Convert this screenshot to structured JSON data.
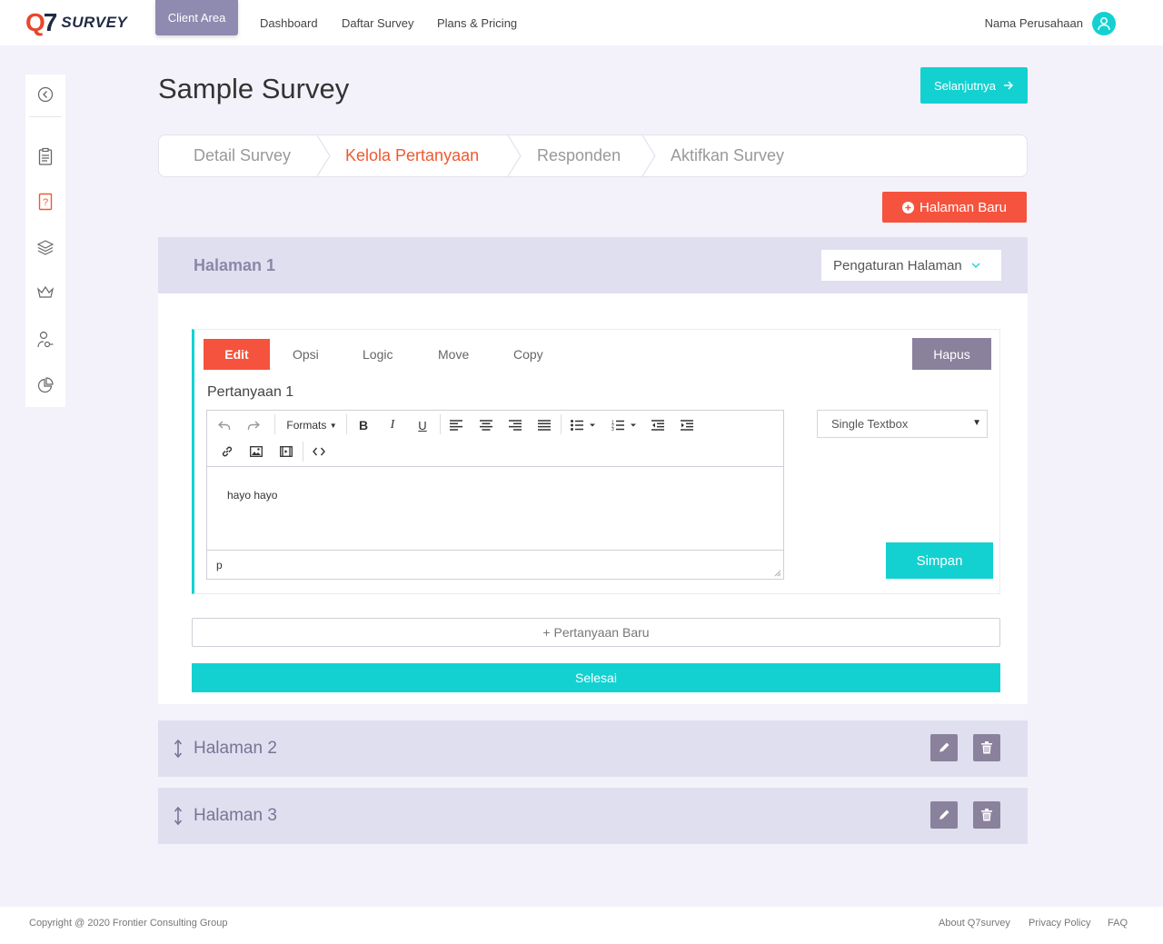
{
  "app": {
    "logo_mark": "Q7",
    "logo_text": "SURVEY"
  },
  "nav": {
    "client_area": "Client Area",
    "dashboard": "Dashboard",
    "daftar_survey": "Daftar Survey",
    "plans_pricing": "Plans & Pricing",
    "user_name": "Nama Perusahaan"
  },
  "sidebar": {
    "items": [
      {
        "icon": "back-circle-icon"
      },
      {
        "icon": "clipboard-icon"
      },
      {
        "icon": "question-book-icon",
        "active": true
      },
      {
        "icon": "layers-icon"
      },
      {
        "icon": "crown-icon"
      },
      {
        "icon": "user-key-icon"
      },
      {
        "icon": "pie-chart-icon"
      }
    ]
  },
  "main": {
    "title": "Sample Survey",
    "next_button": "Selanjutnya",
    "steps": [
      "Detail Survey",
      "Kelola Pertanyaan",
      "Responden",
      "Aktifkan Survey"
    ],
    "active_step": 1,
    "new_page_button": "Halaman Baru"
  },
  "page1": {
    "title": "Halaman 1",
    "settings_label": "Pengaturan Halaman",
    "question": {
      "tabs": [
        "Edit",
        "Opsi",
        "Logic",
        "Move",
        "Copy"
      ],
      "active_tab": "Edit",
      "delete_button": "Hapus",
      "label": "Pertanyaan 1",
      "toolbar_formats": "Formats",
      "content": "hayo hayo",
      "status_path": "p",
      "type_selected": "Single Textbox",
      "save_button": "Simpan"
    },
    "new_question_button": "+ Pertanyaan Baru",
    "done_button": "Selesai"
  },
  "pages": [
    {
      "title": "Halaman 2"
    },
    {
      "title": "Halaman 3"
    }
  ],
  "footer": {
    "copyright": "Copyright @ 2020 Frontier Consulting Group",
    "links": [
      "About Q7survey",
      "Privacy Policy",
      "FAQ"
    ]
  },
  "colors": {
    "accent": "#14d1d1",
    "danger": "#f5533d",
    "muted_purple": "#8a819c",
    "page_header": "#e0dff0",
    "active_step": "#ee5a2f"
  }
}
